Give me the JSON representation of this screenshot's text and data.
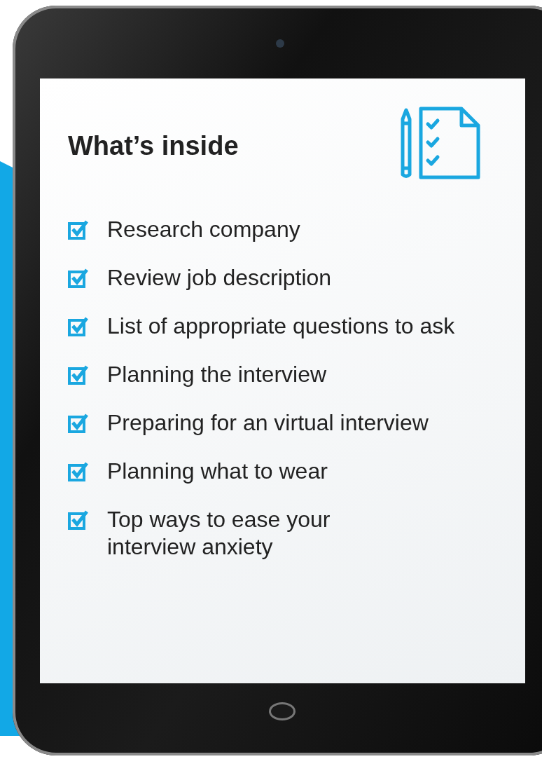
{
  "heading": "What’s inside",
  "items": [
    {
      "text": "Research company",
      "checked": true
    },
    {
      "text": "Review job description",
      "checked": true
    },
    {
      "text": "List of appropriate questions to ask",
      "checked": true
    },
    {
      "text": "Planning the interview",
      "checked": true
    },
    {
      "text": "Preparing for an virtual interview",
      "checked": true
    },
    {
      "text": "Planning what to wear",
      "checked": true
    },
    {
      "text": "Top ways to ease your\ninterview anxiety",
      "checked": true
    }
  ]
}
